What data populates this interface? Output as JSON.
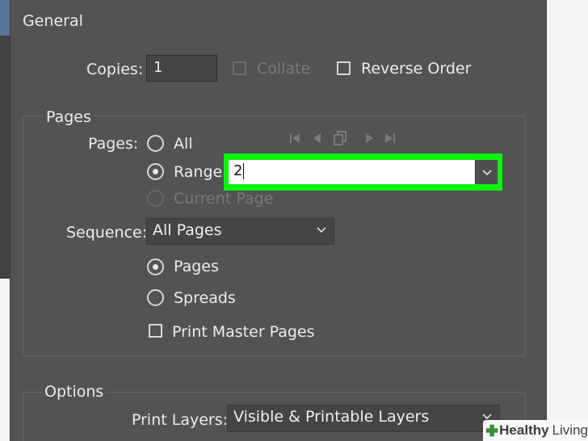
{
  "general": {
    "title": "General",
    "copies_label": "Copies:",
    "copies_value": "1",
    "collate_label": "Collate",
    "reverse_order_label": "Reverse Order"
  },
  "pages_group": {
    "title": "Pages",
    "pages_label": "Pages:",
    "all_label": "All",
    "range_label": "Range:",
    "range_value": "2",
    "current_page_label": "Current Page",
    "sequence_label": "Sequence:",
    "sequence_value": "All Pages",
    "pages_option": "Pages",
    "spreads_option": "Spreads",
    "print_master_pages_label": "Print Master Pages"
  },
  "options_group": {
    "title": "Options",
    "print_layers_label": "Print Layers:",
    "print_layers_value": "Visible & Printable Layers"
  },
  "watermark": {
    "brand1": "Healthy",
    "brand2": "Living"
  },
  "colors": {
    "highlight": "#0ef20e",
    "panel_bg": "#535353"
  }
}
